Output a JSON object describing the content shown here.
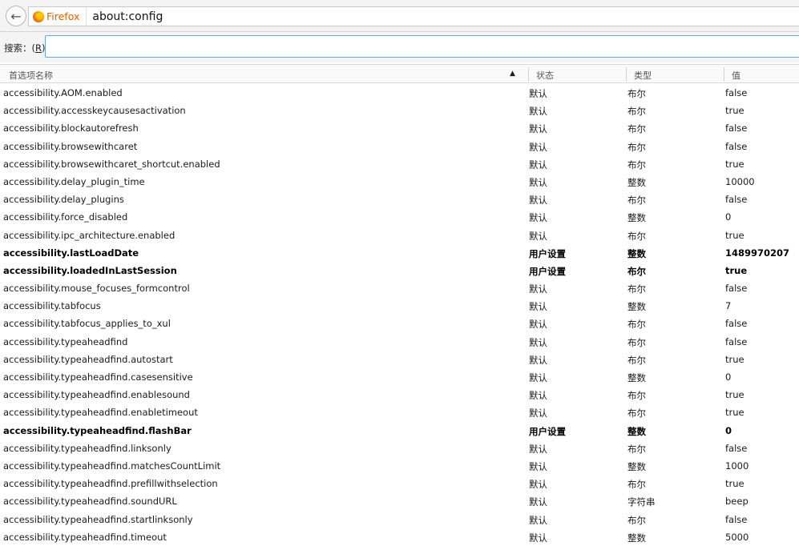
{
  "browser": {
    "brand": "Firefox",
    "url": "about:config"
  },
  "search": {
    "label_prefix": "搜索：(",
    "accesskey": "R",
    "label_suffix": ")",
    "value": ""
  },
  "columns": {
    "name": "首选项名称",
    "status": "状态",
    "type": "类型",
    "value": "值"
  },
  "rows": [
    {
      "name": "accessibility.AOM.enabled",
      "status": "默认",
      "type": "布尔",
      "value": "false",
      "modified": false
    },
    {
      "name": "accessibility.accesskeycausesactivation",
      "status": "默认",
      "type": "布尔",
      "value": "true",
      "modified": false
    },
    {
      "name": "accessibility.blockautorefresh",
      "status": "默认",
      "type": "布尔",
      "value": "false",
      "modified": false
    },
    {
      "name": "accessibility.browsewithcaret",
      "status": "默认",
      "type": "布尔",
      "value": "false",
      "modified": false
    },
    {
      "name": "accessibility.browsewithcaret_shortcut.enabled",
      "status": "默认",
      "type": "布尔",
      "value": "true",
      "modified": false
    },
    {
      "name": "accessibility.delay_plugin_time",
      "status": "默认",
      "type": "整数",
      "value": "10000",
      "modified": false
    },
    {
      "name": "accessibility.delay_plugins",
      "status": "默认",
      "type": "布尔",
      "value": "false",
      "modified": false
    },
    {
      "name": "accessibility.force_disabled",
      "status": "默认",
      "type": "整数",
      "value": "0",
      "modified": false
    },
    {
      "name": "accessibility.ipc_architecture.enabled",
      "status": "默认",
      "type": "布尔",
      "value": "true",
      "modified": false
    },
    {
      "name": "accessibility.lastLoadDate",
      "status": "用户设置",
      "type": "整数",
      "value": "1489970207",
      "modified": true
    },
    {
      "name": "accessibility.loadedInLastSession",
      "status": "用户设置",
      "type": "布尔",
      "value": "true",
      "modified": true
    },
    {
      "name": "accessibility.mouse_focuses_formcontrol",
      "status": "默认",
      "type": "布尔",
      "value": "false",
      "modified": false
    },
    {
      "name": "accessibility.tabfocus",
      "status": "默认",
      "type": "整数",
      "value": "7",
      "modified": false
    },
    {
      "name": "accessibility.tabfocus_applies_to_xul",
      "status": "默认",
      "type": "布尔",
      "value": "false",
      "modified": false
    },
    {
      "name": "accessibility.typeaheadfind",
      "status": "默认",
      "type": "布尔",
      "value": "false",
      "modified": false
    },
    {
      "name": "accessibility.typeaheadfind.autostart",
      "status": "默认",
      "type": "布尔",
      "value": "true",
      "modified": false
    },
    {
      "name": "accessibility.typeaheadfind.casesensitive",
      "status": "默认",
      "type": "整数",
      "value": "0",
      "modified": false
    },
    {
      "name": "accessibility.typeaheadfind.enablesound",
      "status": "默认",
      "type": "布尔",
      "value": "true",
      "modified": false
    },
    {
      "name": "accessibility.typeaheadfind.enabletimeout",
      "status": "默认",
      "type": "布尔",
      "value": "true",
      "modified": false
    },
    {
      "name": "accessibility.typeaheadfind.flashBar",
      "status": "用户设置",
      "type": "整数",
      "value": "0",
      "modified": true
    },
    {
      "name": "accessibility.typeaheadfind.linksonly",
      "status": "默认",
      "type": "布尔",
      "value": "false",
      "modified": false
    },
    {
      "name": "accessibility.typeaheadfind.matchesCountLimit",
      "status": "默认",
      "type": "整数",
      "value": "1000",
      "modified": false
    },
    {
      "name": "accessibility.typeaheadfind.prefillwithselection",
      "status": "默认",
      "type": "布尔",
      "value": "true",
      "modified": false
    },
    {
      "name": "accessibility.typeaheadfind.soundURL",
      "status": "默认",
      "type": "字符串",
      "value": "beep",
      "modified": false
    },
    {
      "name": "accessibility.typeaheadfind.startlinksonly",
      "status": "默认",
      "type": "布尔",
      "value": "false",
      "modified": false
    },
    {
      "name": "accessibility.typeaheadfind.timeout",
      "status": "默认",
      "type": "整数",
      "value": "5000",
      "modified": false
    }
  ]
}
